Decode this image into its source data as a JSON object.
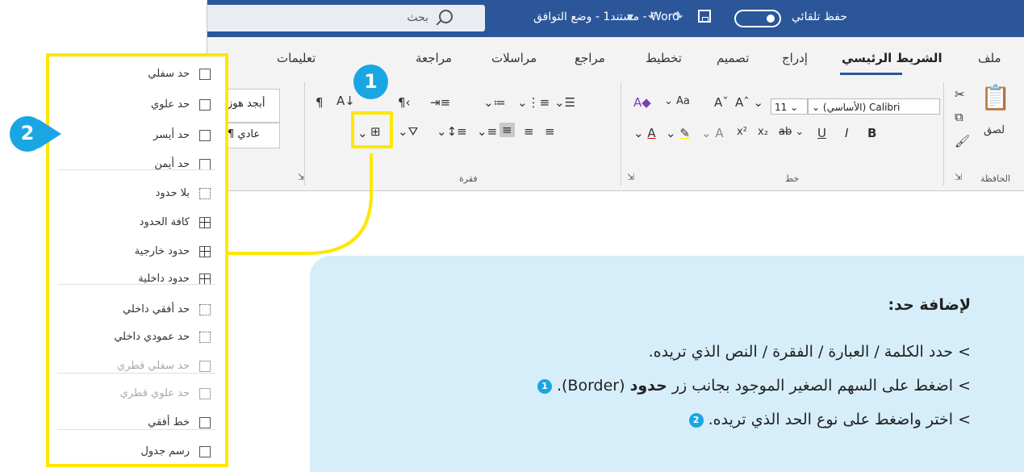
{
  "titlebar": {
    "search_label": "بحث",
    "app": "Word",
    "doc_title": "مستند1 - وضع التوافق - Word",
    "autosave_label": "حفظ تلقائي",
    "toggle_state": "on"
  },
  "tabs": [
    "ملف",
    "الشريط الرئيسي",
    "إدراج",
    "تصميم",
    "تخطيط",
    "مراجع",
    "مراسلات",
    "مراجعة",
    "تعليمات"
  ],
  "active_tab": "الشريط الرئيسي",
  "ribbon": {
    "clipboard": {
      "label": "الحافظة",
      "paste": "لصق"
    },
    "font": {
      "label": "خط",
      "font_name": "(الأساسي) Calibri",
      "font_size": "11"
    },
    "paragraph": {
      "label": "فقرة"
    },
    "styles": {
      "normal": "¶ عادي",
      "sample": "أبجد هوز"
    }
  },
  "callouts": {
    "one": "1",
    "two": "2"
  },
  "menu": {
    "items": [
      {
        "label": "حد سفلي",
        "enabled": true
      },
      {
        "label": "حد علوي",
        "enabled": true
      },
      {
        "label": "حد أيسر",
        "enabled": true
      },
      {
        "label": "حد أيمن",
        "enabled": true
      },
      {
        "label": "بلا حدود",
        "enabled": true
      },
      {
        "label": "كافة الحدود",
        "enabled": true
      },
      {
        "label": "حدود خارجية",
        "enabled": true
      },
      {
        "label": "حدود داخلية",
        "enabled": true
      },
      {
        "label": "حد أفقي داخلي",
        "enabled": true
      },
      {
        "label": "حد عمودي داخلي",
        "enabled": true
      },
      {
        "label": "حد سفلي قطري",
        "enabled": false
      },
      {
        "label": "حد علوي قطري",
        "enabled": false
      },
      {
        "label": "خط أفقي",
        "enabled": true
      },
      {
        "label": "رسم جدول",
        "enabled": true
      }
    ]
  },
  "instructions": {
    "title": "لإضافة حد:",
    "step1": "> حدد الكلمة / العبارة / الفقرة / النص الذي تريده.",
    "step2_pre": "> اضغط على السهم الصغير الموجود بجانب زر ",
    "step2_bold": "حدود",
    "step2_post": " (Border).",
    "step3": "> اختر واضغط على نوع الحد الذي تريده.",
    "step2_badge": "1",
    "step3_badge": "2"
  },
  "colors": {
    "word_blue": "#2b579a",
    "highlight_yellow": "#ffe600",
    "callout_blue": "#1aa6e3",
    "card_bg": "#d6eefa"
  }
}
